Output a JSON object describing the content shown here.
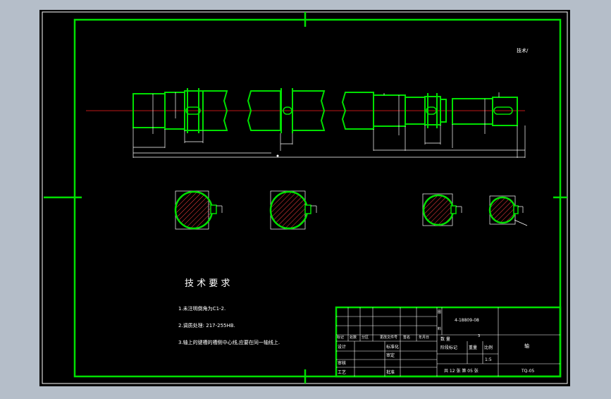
{
  "drawing": {
    "scale_note": "技术/",
    "requirements": {
      "title": "技 术 要 求",
      "items": [
        "1.未注明倒角为C1-2.",
        "2.调质处理: 217-255HB.",
        "3.轴上的键槽的槽侧中心线,应要在同一轴线上."
      ]
    },
    "title_block": {
      "drawing_no": "4-18809-08",
      "part_name": "轴",
      "scale": "1:5",
      "quantity": "3",
      "sheet_info": "共 12 张 第 05 张",
      "code": "TQ-05",
      "labels": {
        "mark": "标记",
        "count": "处数",
        "zone": "分区",
        "change_doc": "更改文件号",
        "signature": "签名",
        "date": "年月日",
        "designer": "设计",
        "standardize": "标准化",
        "checker": "审核",
        "craft": "工艺",
        "approve": "批准",
        "process": "审定",
        "stage_mark": "阶段标记",
        "weight": "重量",
        "ratio": "比例",
        "qty_label": "数 量"
      }
    }
  }
}
